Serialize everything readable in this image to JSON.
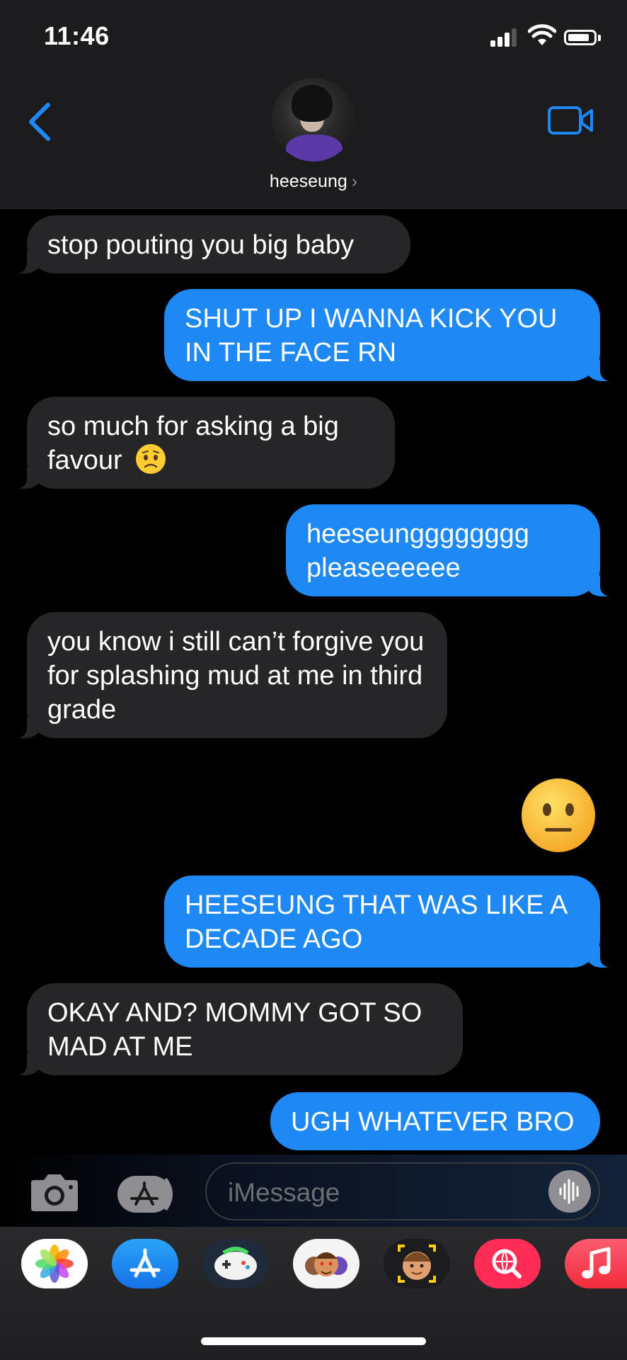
{
  "status_bar": {
    "time": "11:46"
  },
  "header": {
    "contact_name": "heeseung",
    "name_chevron": "›"
  },
  "messages": [
    {
      "direction": "incoming",
      "text": "stop pouting you big baby"
    },
    {
      "direction": "outgoing",
      "text": "SHUT UP I WANNA KICK YOU IN THE FACE RN"
    },
    {
      "direction": "incoming",
      "text": "so much for asking a big favour"
    },
    {
      "direction": "outgoing",
      "text": "heeseungggggggg pleaseeeeee"
    },
    {
      "direction": "incoming",
      "text": "you know i still can’t forgive you for splashing mud at me in third grade"
    },
    {
      "direction": "outgoing",
      "text": "neutral-face-emoji"
    },
    {
      "direction": "outgoing",
      "text": "HEESEUNG THAT WAS LIKE A DECADE AGO"
    },
    {
      "direction": "incoming",
      "text": "OKAY AND? MOMMY GOT SO MAD AT ME"
    },
    {
      "direction": "outgoing",
      "text": "UGH WHATEVER BRO"
    }
  ],
  "input": {
    "placeholder": "iMessage"
  },
  "icons": {
    "back": "chevron-left-icon",
    "video": "video-camera-icon",
    "camera": "camera-icon",
    "apps": "app-store-icon",
    "audio": "waveform-icon",
    "worried_emoji": "worried-face-emoji",
    "drawer_apps": [
      "photos-app-icon",
      "app-store-app-icon",
      "game-app-icon",
      "memoji-stickers-app-icon",
      "memoji-app-icon",
      "search-images-app-icon",
      "music-app-icon"
    ]
  },
  "colors": {
    "accent": "#1e88f5",
    "incoming_bubble": "#262628",
    "header_bg": "#1c1c1e"
  }
}
